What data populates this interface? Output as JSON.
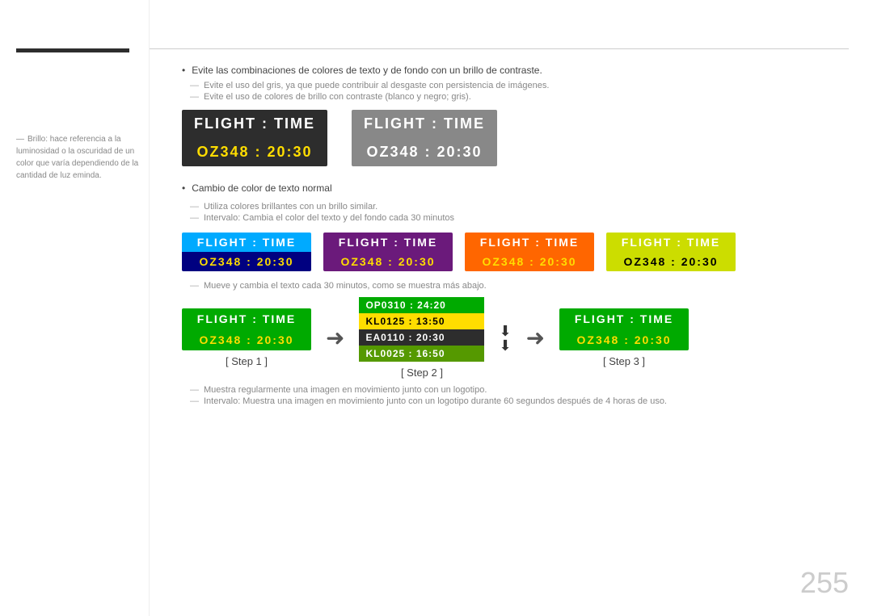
{
  "sidebar": {
    "note": "Brillo: hace referencia a la luminosidad o la oscuridad de un color que varía dependiendo de la cantidad de luz eminda."
  },
  "header": {
    "bullets": [
      "Evite las combinaciones de colores de texto y de fondo con un brillo de contraste.",
      "Evite el uso del gris, ya que puede contribuir al desgaste con persistencia de imágenes.",
      "Evite el uso de colores de brillo con contraste (blanco y negro; gris)."
    ]
  },
  "panels_row1": [
    {
      "id": "dark",
      "top": "FLIGHT  :  TIME",
      "bottom": "OZ348  :  20:30"
    },
    {
      "id": "gray",
      "top": "FLIGHT  :  TIME",
      "bottom": "OZ348  :  20:30"
    }
  ],
  "section2": {
    "bullet": "Cambio de color de texto normal",
    "dashes": [
      "Utiliza colores brillantes con un brillo similar.",
      "Intervalo: Cambia el color del texto y del fondo cada 30 minutos"
    ]
  },
  "panels_row2": [
    {
      "id": "cyan",
      "top": "FLIGHT  :  TIME",
      "bottom": "OZ348  :  20:30"
    },
    {
      "id": "purple",
      "top": "FLIGHT  :  TIME",
      "bottom": "OZ348  :  20:30"
    },
    {
      "id": "orange",
      "top": "FLIGHT  :  TIME",
      "bottom": "OZ348  :  20:30"
    },
    {
      "id": "yellowgreen",
      "top": "FLIGHT  :  TIME",
      "bottom": "OZ348  :  20:30"
    }
  ],
  "steps_section": {
    "dash": "Mueve y cambia el texto cada 30 minutos, como se muestra más abajo.",
    "step1": {
      "label": "[ Step 1 ]",
      "top": "FLIGHT  :  TIME",
      "bottom": "OZ348  :  20:30"
    },
    "step2": {
      "label": "[ Step 2 ]",
      "rows": [
        {
          "text": "OP0310  :  24:20",
          "style": "green"
        },
        {
          "text": "KL0125  :  13:50",
          "style": "yellow"
        },
        {
          "text": "EA0110  :  20:30",
          "style": "dark"
        },
        {
          "text": "KL0025  :  16:50",
          "style": "olive"
        }
      ]
    },
    "step3": {
      "label": "[ Step 3 ]",
      "top": "FLIGHT  :  TIME",
      "bottom": "OZ348  :  20:30"
    }
  },
  "footer": {
    "bullets": [
      "Muestra regularmente una imagen en movimiento junto con un logotipo.",
      "Intervalo: Muestra una imagen en movimiento junto con un logotipo durante 60 segundos después de 4 horas de uso."
    ]
  },
  "page_number": "255"
}
